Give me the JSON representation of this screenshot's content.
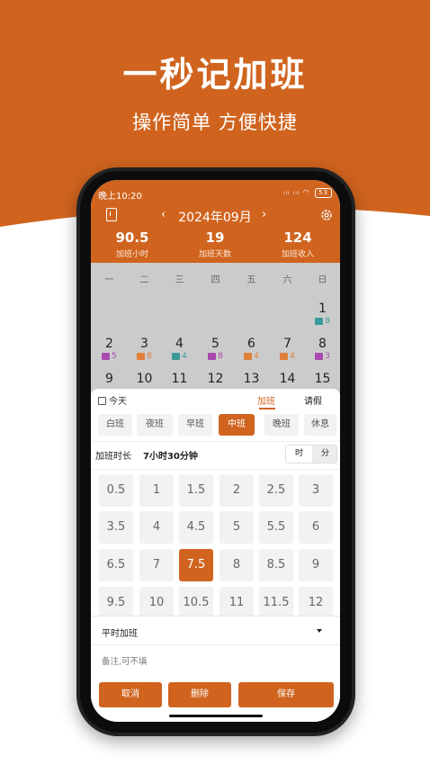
{
  "promo": {
    "headline": "一秒记加班",
    "subheadline": "操作简单 方便快捷",
    "brand_color": "#d0641f"
  },
  "status_bar": {
    "time": "晚上10:20",
    "signal": "ᵢₗₗ ᵢₗₗ",
    "battery": "53"
  },
  "header": {
    "month": "2024年09月",
    "prev": "‹",
    "next": "›",
    "stats": [
      {
        "value": "90.5",
        "label": "加班小时"
      },
      {
        "value": "19",
        "label": "加班天数"
      },
      {
        "value": "124",
        "label": "加班收入"
      }
    ]
  },
  "calendar": {
    "weekdays": [
      "一",
      "二",
      "三",
      "四",
      "五",
      "六",
      "日"
    ],
    "week1": {
      "day": "1",
      "tag": "8"
    },
    "week2": [
      {
        "day": "2",
        "tag": "5"
      },
      {
        "day": "3",
        "tag": "8"
      },
      {
        "day": "4",
        "tag": "4"
      },
      {
        "day": "5",
        "tag": "8"
      },
      {
        "day": "6",
        "tag": "4"
      },
      {
        "day": "7",
        "tag": "4"
      },
      {
        "day": "8",
        "tag": "3"
      }
    ],
    "week3": [
      "9",
      "10",
      "11",
      "12",
      "13",
      "14",
      "15"
    ],
    "chip_colors": {
      "teal": "#3a9a9a",
      "purple": "#a94ab0",
      "orange": "#e0803a"
    }
  },
  "sheet": {
    "today": "今天",
    "tabs": [
      "加班",
      "请假"
    ],
    "shifts": [
      "白班",
      "夜班",
      "早班",
      "中班",
      "晚班",
      "休息"
    ],
    "selected_shift": "中班",
    "duration_label": "加班时长",
    "duration_value": "7小时30分钟",
    "units": [
      "时",
      "分"
    ],
    "hours": [
      [
        "0.5",
        "1",
        "1.5",
        "2",
        "2.5",
        "3"
      ],
      [
        "3.5",
        "4",
        "4.5",
        "5",
        "5.5",
        "6"
      ],
      [
        "6.5",
        "7",
        "7.5",
        "8",
        "8.5",
        "9"
      ],
      [
        "9.5",
        "10",
        "10.5",
        "11",
        "11.5",
        "12"
      ]
    ],
    "selected_hour": "7.5",
    "overtime_type": "平时加班",
    "remark_placeholder": "备注,可不填",
    "buttons": {
      "cancel": "取消",
      "delete": "删除",
      "save": "保存"
    }
  }
}
